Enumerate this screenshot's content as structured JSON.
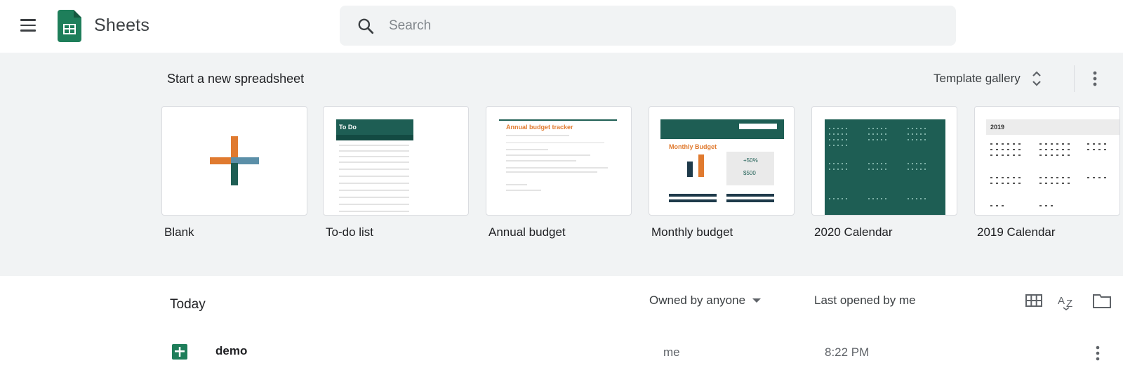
{
  "header": {
    "app_title": "Sheets",
    "search_placeholder": "Search",
    "menu_icon": "hamburger-menu-icon",
    "logo_icon": "sheets-logo-icon",
    "search_icon": "search-icon"
  },
  "templates": {
    "section_title": "Start a new spreadsheet",
    "gallery_label": "Template gallery",
    "items": [
      {
        "label": "Blank"
      },
      {
        "label": "To-do list",
        "thumb_title": "To Do"
      },
      {
        "label": "Annual budget",
        "thumb_title": "Annual budget tracker"
      },
      {
        "label": "Monthly budget",
        "thumb_title": "Monthly Budget",
        "thumb_value1": "+50%",
        "thumb_value2": "$500"
      },
      {
        "label": "2020 Calendar"
      },
      {
        "label": "2019 Calendar",
        "thumb_title": "2019"
      }
    ]
  },
  "recent": {
    "section_title": "Today",
    "owner_filter": "Owned by anyone",
    "sort_label": "Last opened by me",
    "files": [
      {
        "name": "demo",
        "owner": "me",
        "time": "8:22 PM"
      }
    ]
  },
  "colors": {
    "sheets_green": "#0f9d58",
    "dark_teal": "#1e5e54",
    "orange": "#e07a2f",
    "slate_blue": "#5b8fa8",
    "panel_bg": "#f1f3f4"
  }
}
